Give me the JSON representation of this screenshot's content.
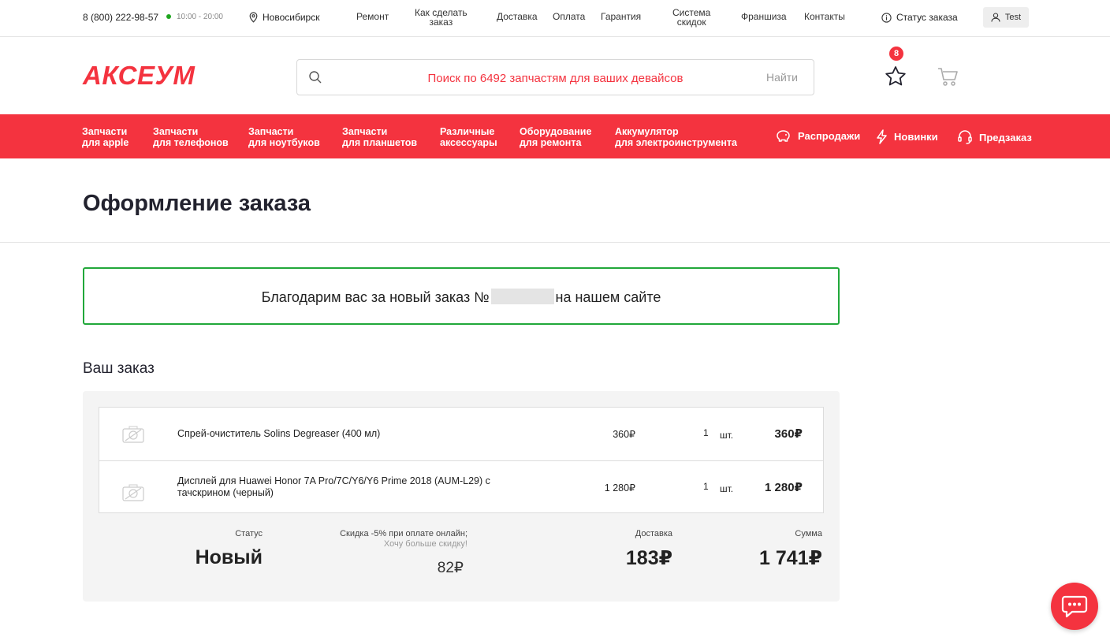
{
  "topbar": {
    "phone": "8 (800) 222-98-57",
    "hours": "10:00 - 20:00",
    "city": "Новосибирск",
    "nav": {
      "repair": "Ремонт",
      "how_line1": "Как сделать",
      "how_line2": "заказ",
      "delivery": "Доставка",
      "payment": "Оплата",
      "warranty": "Гарантия",
      "discount_line1": "Система",
      "discount_line2": "скидок",
      "franchise": "Франшиза",
      "contacts": "Контакты"
    },
    "order_status": "Статус заказа",
    "user": "Test"
  },
  "header": {
    "logo": "АКСЕУМ",
    "search_placeholder": "Поиск по 6492 запчастям для ваших девайсов",
    "search_button": "Найти",
    "favorites_count": "8"
  },
  "menu": {
    "items": [
      {
        "l1": "Запчасти",
        "l2": "для apple"
      },
      {
        "l1": "Запчасти",
        "l2": "для телефонов"
      },
      {
        "l1": "Запчасти",
        "l2": "для ноутбуков"
      },
      {
        "l1": "Запчасти",
        "l2": "для планшетов"
      },
      {
        "l1": "Различные",
        "l2": "аксессуары"
      },
      {
        "l1": "Оборудование",
        "l2": "для ремонта"
      },
      {
        "l1": "Аккумулятор",
        "l2": "для электроинструмента"
      }
    ],
    "sales": "Распродажи",
    "new": "Новинки",
    "preorder": "Предзаказ"
  },
  "page": {
    "title": "Оформление заказа",
    "thanks_before": "Благодарим вас за новый заказ №",
    "thanks_after": "на нашем сайте",
    "order_title": "Ваш заказ"
  },
  "order": {
    "items": [
      {
        "name": "Спрей-очиститель Solins Degreaser (400 мл)",
        "price": "360₽",
        "qty": "1",
        "unit": "шт.",
        "sum": "360₽"
      },
      {
        "name": "Дисплей для Huawei Honor 7A Pro/7C/Y6/Y6 Prime 2018 (AUM-L29) с тачскрином (черный)",
        "price": "1 280₽",
        "qty": "1",
        "unit": "шт.",
        "sum": "1 280₽"
      }
    ],
    "status_label": "Статус",
    "status_value": "Новый",
    "discount_note": "Скидка -5% при оплате онлайн;",
    "discount_more": "Хочу больше скидку!",
    "discount_value": "82₽",
    "delivery_label": "Доставка",
    "delivery_value": "183₽",
    "total_label": "Сумма",
    "total_value": "1 741₽"
  },
  "colors": {
    "accent": "#f4333f",
    "success": "#21a83a"
  }
}
